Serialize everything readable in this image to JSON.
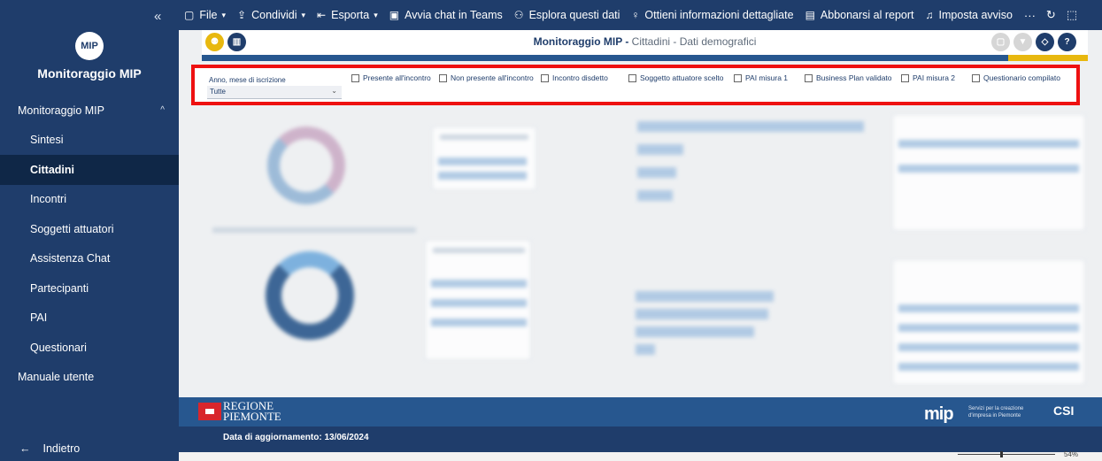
{
  "sidebar": {
    "collapse_glyph": "«",
    "app_name": "Monitoraggio MIP",
    "logo_text": "MIP",
    "nav": [
      {
        "label": "Monitoraggio MIP",
        "level": 0,
        "group": true,
        "chevron": "^"
      },
      {
        "label": "Sintesi",
        "level": 1
      },
      {
        "label": "Cittadini",
        "level": 1,
        "active": true
      },
      {
        "label": "Incontri",
        "level": 1
      },
      {
        "label": "Soggetti attuatori",
        "level": 1
      },
      {
        "label": "Assistenza Chat",
        "level": 1
      },
      {
        "label": "Partecipanti",
        "level": 1
      },
      {
        "label": "PAI",
        "level": 1
      },
      {
        "label": "Questionari",
        "level": 1
      },
      {
        "label": "Manuale utente",
        "level": 0
      }
    ],
    "back_label": "Indietro",
    "back_icon": "←"
  },
  "toolbar": {
    "file": "File",
    "share": "Condividi",
    "export": "Esporta",
    "teams": "Avvia chat in Teams",
    "explore": "Esplora questi dati",
    "details": "Ottieni informazioni dettagliate",
    "subscribe": "Abbonarsi al report",
    "alert": "Imposta avviso",
    "more": "···",
    "refresh_icon": "↻",
    "bookmark_icon": "⬚"
  },
  "report": {
    "title_bold": "Monitoraggio MIP -",
    "title_rest": " Cittadini - Dati demografici"
  },
  "filters": {
    "period_label": "Anno, mese di iscrizione",
    "period_value": "Tutte",
    "checks": [
      "Presente all'incontro",
      "Non presente all'incontro",
      "Incontro disdetto",
      "Soggetto attuatore scelto",
      "PAI misura 1",
      "Business Plan validato",
      "PAI misura 2",
      "Questionario compilato"
    ]
  },
  "footer": {
    "region_line1": "REGIONE",
    "region_line2": "PIEMONTE",
    "update_text": "Data di aggiornamento: 13/06/2024",
    "mip_logo": "mip",
    "mip_tagline_1": "Servizi per la creazione",
    "mip_tagline_2": "d'impresa in Piemonte",
    "csi_logo": "CSI"
  },
  "status": {
    "zoom": "54%"
  },
  "colors": {
    "nav_bg": "#1f3d6b",
    "nav_active": "#0f2747",
    "accent_yellow": "#e8b80f",
    "highlight_red": "#ee1111"
  }
}
